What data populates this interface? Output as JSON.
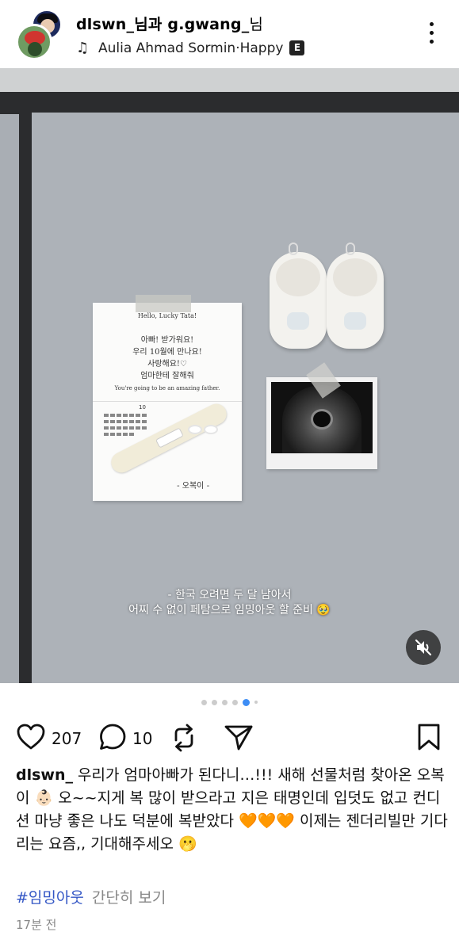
{
  "header": {
    "user1": "dlswn_",
    "conj": "님과 ",
    "user2": "g.gwang_",
    "suffix": "님",
    "music_artist": "Aulia Ahmad Sormin",
    "music_sep": " · ",
    "music_title": "Happy",
    "explicit_badge": "E"
  },
  "photo": {
    "card_greeting": "Hello, Lucky Tata!",
    "card_lines": [
      "아빠! 받가워요!",
      "우리 10월에 만나요!",
      "사랑해요!♡",
      "엄마한테 잘해줘"
    ],
    "card_footer": "You're going to be an amazing father.",
    "card_calendar_month": "10",
    "card_sign": "- 오복이 -",
    "caption_line1": "- 한국 오려면 두 달 남아서",
    "caption_line2": "어찌 수 없이 페탐으로 임밍아웃 할 준비 🥹"
  },
  "carousel": {
    "total": 6,
    "active_index": 4
  },
  "actions": {
    "like_count": "207",
    "comment_count": "10"
  },
  "post": {
    "username": "dlswn_",
    "text": " 우리가 엄마아빠가 된다니…!!! 새해 선물처럼 찾아온 오복이 👶🏻 오~~지게 복 많이 받으라고 지은 태명인데 입덧도 없고 컨디션 마냥 좋은 나도 덕분에 복받았다 🧡🧡🧡 이제는 젠더리빌만 기다리는 요즘,, 기대해주세오 🫢",
    "hashtag": "#임밍아웃",
    "more": "간단히 보기",
    "time": "17분 전"
  },
  "colors": {
    "hashtag": "#3356c5",
    "active_dot": "#3d8df5",
    "muted_text": "#888888"
  },
  "icons": [
    "music-note-icon",
    "more-icon",
    "mute-icon",
    "heart-icon",
    "comment-icon",
    "repost-icon",
    "share-icon",
    "bookmark-icon"
  ]
}
